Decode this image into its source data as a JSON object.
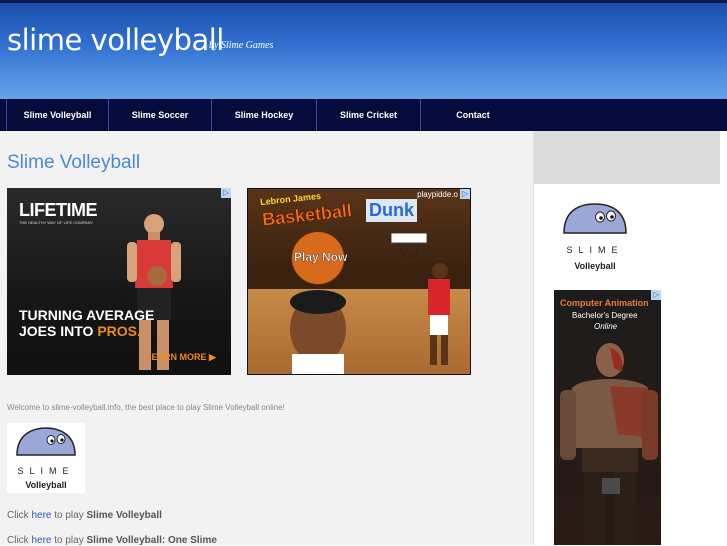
{
  "header": {
    "title": "slime volleyball",
    "byline": "by Slime Games"
  },
  "nav": {
    "items": [
      {
        "label": "Slime Volleyball"
      },
      {
        "label": "Slime Soccer"
      },
      {
        "label": "Slime Hockey"
      },
      {
        "label": "Slime Cricket"
      },
      {
        "label": "Contact"
      }
    ]
  },
  "main": {
    "title": "Slime Volleyball",
    "intro": "Welcome to slime-volleyball.info, the best place to play Slime Volleyball online!",
    "logo": {
      "word": "SLIME",
      "sub": "Volleyball"
    },
    "links": [
      {
        "prefix": "Click ",
        "link": "here",
        "middle": " to play ",
        "game": "Slime Volleyball"
      },
      {
        "prefix": "Click ",
        "link": "here",
        "middle": " to play ",
        "game": "Slime Volleyball: One Slime"
      }
    ]
  },
  "ads": {
    "lifetime": {
      "logo": "LIFETIME",
      "tagline": "THE HEALTHY WAY OF LIFE COMPANY",
      "headline1": "TURNING AVERAGE",
      "headline2": "JOES INTO ",
      "headline3": "PROS.",
      "cta": "LEARN MORE ▶"
    },
    "basketball": {
      "title_small": "Lebron James",
      "title": "Basketball",
      "dunk": "Dunk",
      "site": "playpidde.o",
      "cta": "Play Now"
    },
    "sidebar": {
      "title": "Computer Animation",
      "degree": "Bachelor's Degree",
      "mode": "Online"
    },
    "adchoice_icon": "adchoices-icon"
  },
  "sidebar": {
    "logo": {
      "word": "SLIME",
      "sub": "Volleyball"
    }
  },
  "colors": {
    "nav_bg": "#060b3c",
    "title_blue": "#4a8ad0",
    "link_blue": "#2a5ab8",
    "accent_orange": "#f28a1c"
  }
}
